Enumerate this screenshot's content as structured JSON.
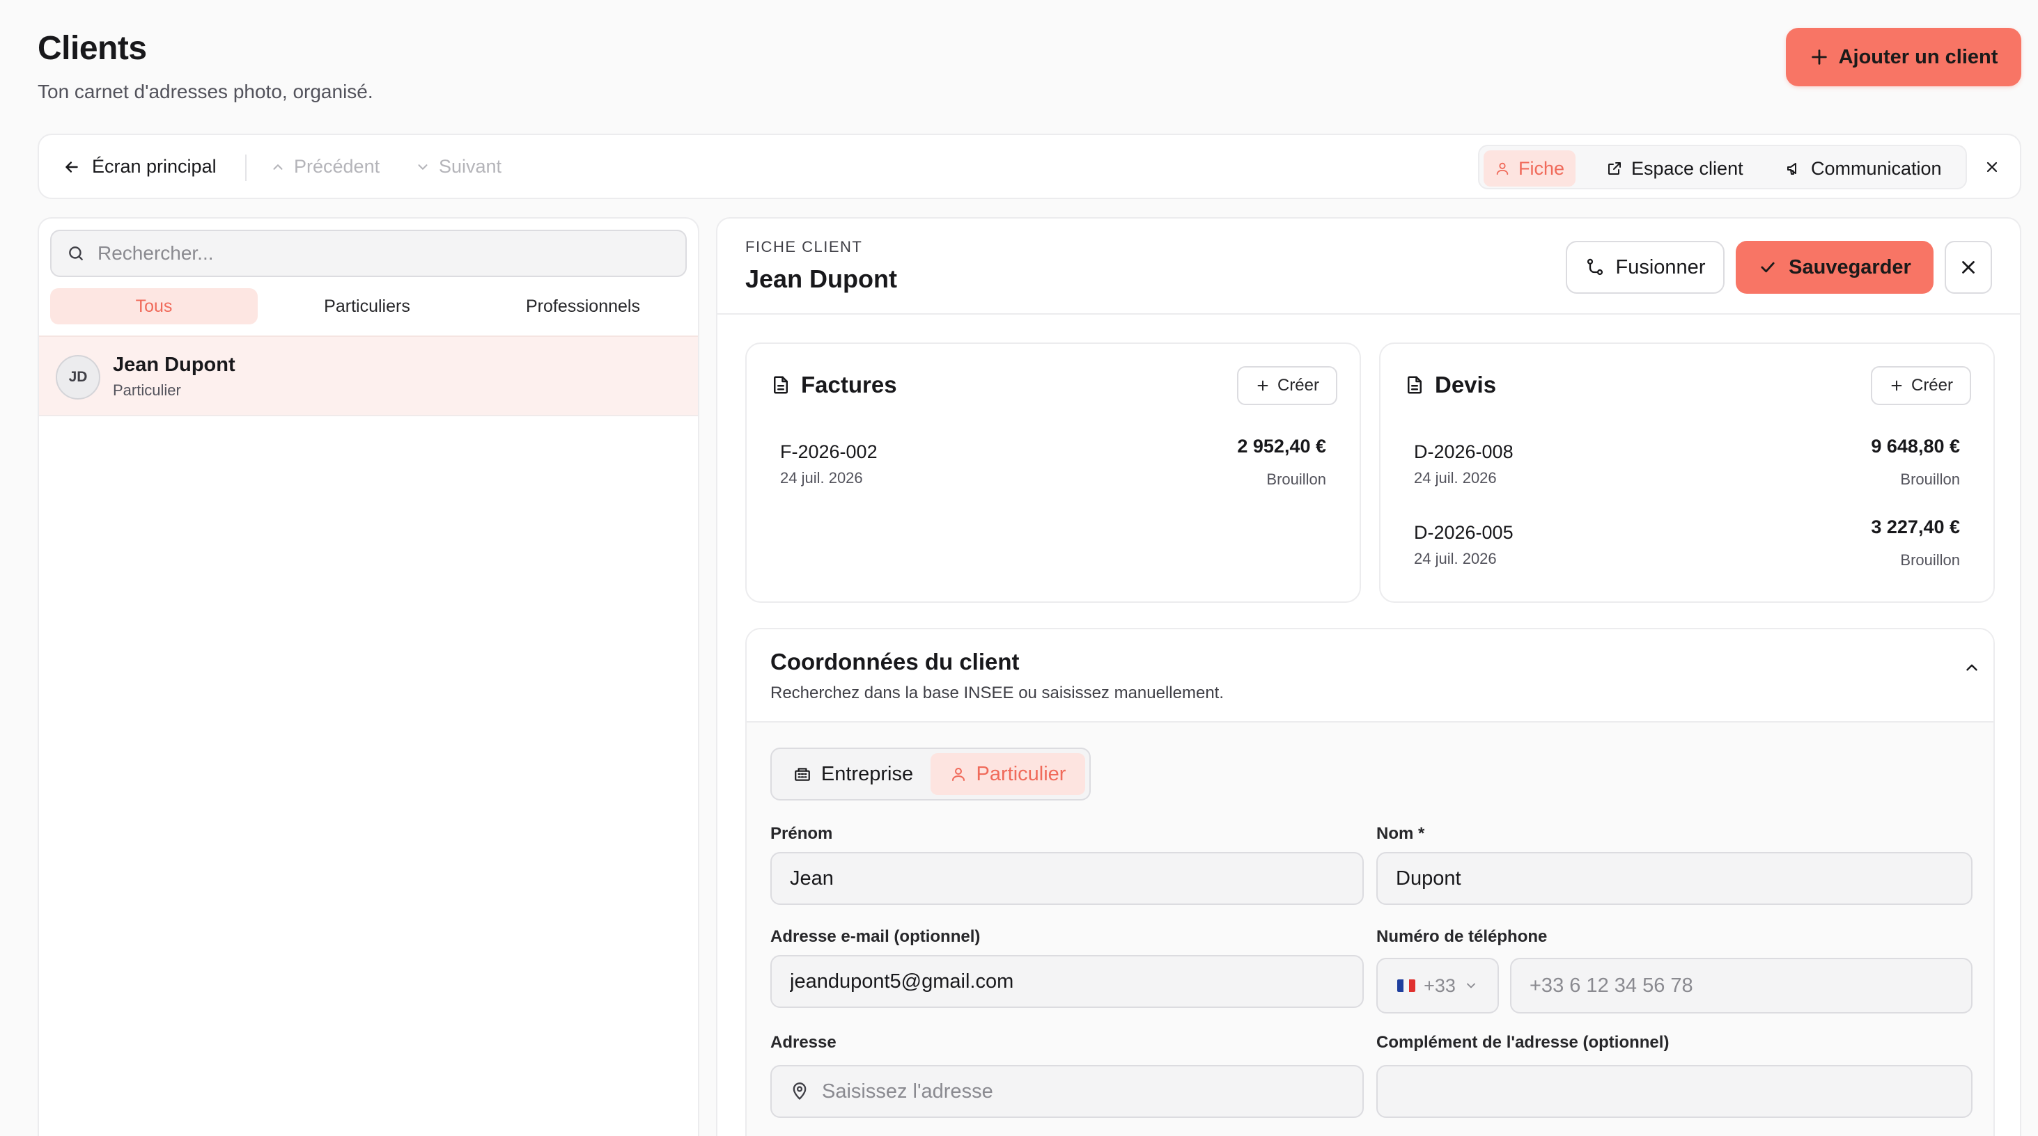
{
  "header": {
    "title": "Clients",
    "subtitle": "Ton carnet d'adresses photo, organisé.",
    "add_button": "Ajouter un client"
  },
  "navbar": {
    "back": "Écran principal",
    "previous": "Précédent",
    "next": "Suivant",
    "tabs": [
      {
        "label": "Fiche",
        "active": true
      },
      {
        "label": "Espace client",
        "active": false
      },
      {
        "label": "Communication",
        "active": false
      }
    ]
  },
  "left_panel": {
    "search_placeholder": "Rechercher...",
    "filters": [
      {
        "label": "Tous",
        "active": true
      },
      {
        "label": "Particuliers",
        "active": false
      },
      {
        "label": "Professionnels",
        "active": false
      }
    ],
    "clients": [
      {
        "initials": "JD",
        "name": "Jean Dupont",
        "type": "Particulier",
        "selected": true
      }
    ]
  },
  "detail": {
    "label": "FICHE CLIENT",
    "name": "Jean Dupont",
    "merge_button": "Fusionner",
    "save_button": "Sauvegarder",
    "invoices": {
      "title": "Factures",
      "create": "Créer",
      "items": [
        {
          "number": "F-2026-002",
          "date": "24 juil. 2026",
          "amount": "2 952,40 €",
          "status": "Brouillon"
        }
      ]
    },
    "quotes": {
      "title": "Devis",
      "create": "Créer",
      "items": [
        {
          "number": "D-2026-008",
          "date": "24 juil. 2026",
          "amount": "9 648,80 €",
          "status": "Brouillon"
        },
        {
          "number": "D-2026-005",
          "date": "24 juil. 2026",
          "amount": "3 227,40 €",
          "status": "Brouillon"
        }
      ]
    },
    "coordinates": {
      "title": "Coordonnées du client",
      "subtitle": "Recherchez dans la base INSEE ou saisissez manuellement.",
      "type_options": [
        {
          "label": "Entreprise",
          "active": false
        },
        {
          "label": "Particulier",
          "active": true
        }
      ],
      "first_name": {
        "label": "Prénom",
        "value": "Jean"
      },
      "last_name": {
        "label": "Nom *",
        "value": "Dupont"
      },
      "email": {
        "label": "Adresse e-mail (optionnel)",
        "value": "jeandupont5@gmail.com"
      },
      "phone": {
        "label": "Numéro de téléphone",
        "prefix": "+33",
        "value": "",
        "placeholder": "+33 6 12 34 56 78"
      },
      "address": {
        "label": "Adresse",
        "value": "",
        "placeholder": "Saisissez l'adresse"
      },
      "address_extra": {
        "label": "Complément de l'adresse (optionnel)",
        "value": "",
        "placeholder": ""
      }
    }
  },
  "colors": {
    "accent": "#f87565",
    "accent_soft": "#fde4e0",
    "accent_text": "#f06a5a",
    "border": "#ececee"
  }
}
